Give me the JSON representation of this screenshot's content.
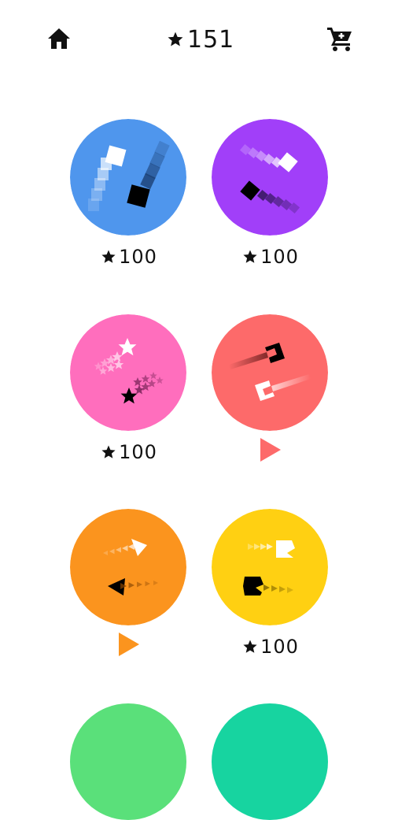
{
  "header": {
    "home_icon": "home-icon",
    "star_balance": "151",
    "cart_icon": "cart-icon"
  },
  "skins": [
    {
      "color": "#4f96ed",
      "icon": "square-trail",
      "price": "100",
      "state": "locked"
    },
    {
      "color": "#a13ff9",
      "icon": "diamond-trail",
      "price": "100",
      "state": "locked"
    },
    {
      "color": "#ff6ebd",
      "icon": "star-trail",
      "price": "100",
      "state": "locked"
    },
    {
      "color": "#fd6a6a",
      "icon": "bracket-trail",
      "price": "",
      "state": "play"
    },
    {
      "color": "#fb941e",
      "icon": "arrow-trail",
      "price": "",
      "state": "play"
    },
    {
      "color": "#ffd012",
      "icon": "pacman-trail",
      "price": "100",
      "state": "locked"
    },
    {
      "color": "#5ae07a",
      "icon": "partial-circle",
      "price": "",
      "state": "cut-off"
    },
    {
      "color": "#17d4a0",
      "icon": "partial-circle",
      "price": "",
      "state": "cut-off"
    }
  ]
}
